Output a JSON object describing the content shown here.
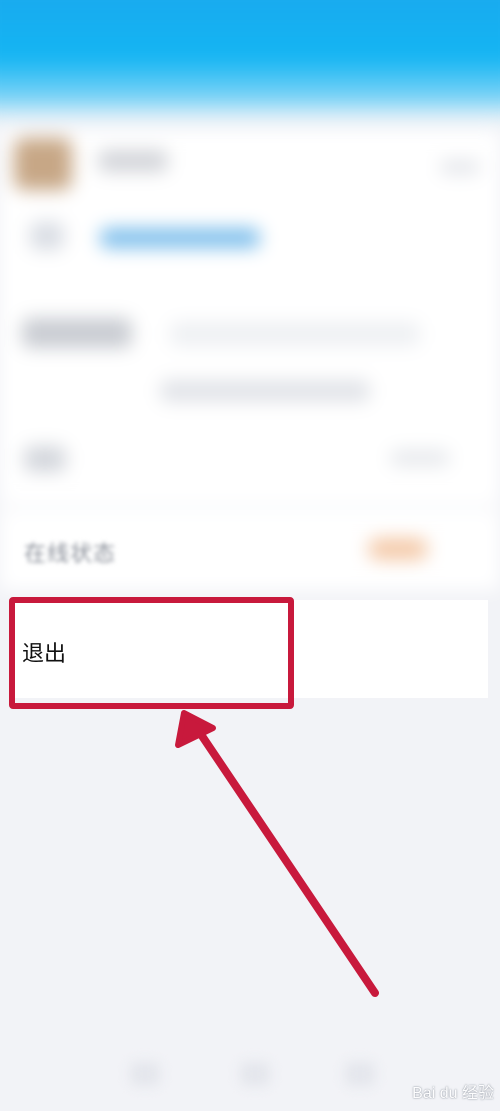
{
  "settings": {
    "online_status_label": "在线状态",
    "logout_label": "退出"
  },
  "watermark": {
    "text": "Bai du 经验"
  },
  "colors": {
    "header": "#14b5f3",
    "highlight": "#c8193c",
    "background": "#f2f3f7"
  }
}
